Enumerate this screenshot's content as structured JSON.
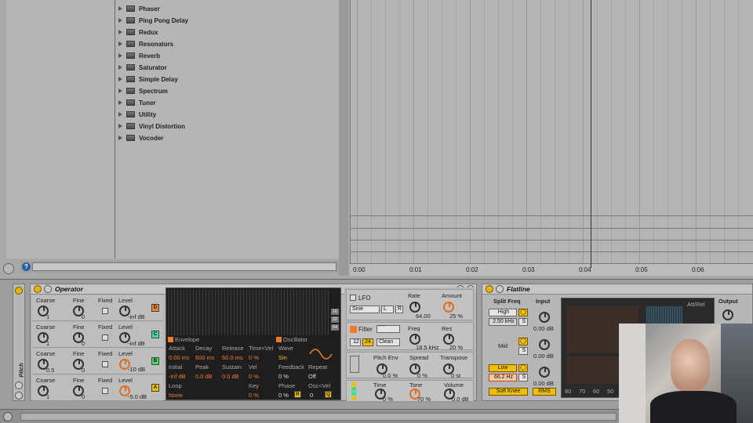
{
  "browser": {
    "items": [
      "Phaser",
      "Ping Pong Delay",
      "Redux",
      "Resonators",
      "Reverb",
      "Saturator",
      "Simple Delay",
      "Spectrum",
      "Tuner",
      "Utility",
      "Vinyl Distortion",
      "Vocoder"
    ],
    "help_label": "?"
  },
  "timeline": {
    "labels": [
      "0:00",
      "0:01",
      "0:02",
      "0:03",
      "0:04",
      "0:05",
      "0:06"
    ]
  },
  "operator": {
    "title": "Operator",
    "track_label": "Pitch",
    "headers": {
      "coarse": "Coarse",
      "fine": "Fine",
      "fixed": "Fixed",
      "level": "Level"
    },
    "rows": [
      {
        "coarse": "1",
        "fine": "0",
        "level": "-inf dB",
        "letter": "D",
        "color": "#f08c2a"
      },
      {
        "coarse": "1",
        "fine": "0",
        "level": "-inf dB",
        "letter": "C",
        "color": "#44dda0"
      },
      {
        "coarse": "0.5",
        "fine": "0",
        "level": "-10 dB",
        "letter": "B",
        "color": "#44dd66"
      },
      {
        "coarse": "1",
        "fine": "0",
        "level": "-5.0 dB",
        "letter": "A",
        "color": "#f0c000"
      }
    ],
    "display": {
      "side_tabs": [
        "16",
        "32",
        "64"
      ],
      "envelope_label": "Envelope",
      "oscillator_label": "Oscillator",
      "attack_label": "Attack",
      "attack": "0.00 ms",
      "decay_label": "Decay",
      "decay": "600 ms",
      "release_label": "Release",
      "release": "50.0 ms",
      "timevel_label": "Time<Vel",
      "timevel": "0 %",
      "wave_label": "Wave",
      "wave": "Sin",
      "initial_label": "Initial",
      "initial": "-inf dB",
      "peak_label": "Peak",
      "peak": "0.0 dB",
      "sustain_label": "Sustain",
      "sustain": "0.0 dB",
      "vel_label": "Vel",
      "vel": "0 %",
      "feedback_label": "Feedback",
      "feedback": "0 %",
      "repeat_label": "Repeat",
      "repeat": "Off",
      "loop_label": "Loop",
      "loop": "None",
      "key_label": "Key",
      "key": "0 %",
      "phase_label": "Phase",
      "phase": "0 %",
      "phase_r": "R",
      "oscvel_label": "Osc<Vel",
      "oscvel": "0",
      "q_label": "Q"
    },
    "lfo": {
      "label": "LFO",
      "wave": "Sine",
      "mode": "L",
      "r": "R",
      "rate_label": "Rate",
      "rate": "64.00",
      "amount_label": "Amount",
      "amount": "25 %"
    },
    "filter": {
      "label": "Filter",
      "slope12": "12",
      "slope24": "24",
      "type": "Clean",
      "freq_label": "Freq",
      "freq": "18.5 kHz",
      "res_label": "Res",
      "res": "20 %"
    },
    "pitch_env": {
      "label": "Pitch Env",
      "value": "0.0 %",
      "spread_label": "Spread",
      "spread": "0 %",
      "transpose_label": "Transpose",
      "transpose": "0 st"
    },
    "bottom": {
      "time_label": "Time",
      "time": "0 %",
      "tone_label": "Tone",
      "tone": "70 %",
      "volume_label": "Volume",
      "volume": "0.0 dB"
    }
  },
  "flatline": {
    "title": "Flatline",
    "split_label": "Split Freq",
    "high_label": "High",
    "high_freq": "2.50 kHz",
    "mid_label": "Mid",
    "low_label": "Low",
    "low_freq": "66.2 Hz",
    "s_label": "S",
    "input_label": "Input",
    "input_values": [
      "0.00 dB",
      "0.00 dB",
      "0.00 dB"
    ],
    "soft_knee": "Soft Knee",
    "rms": "RMS",
    "att_rel": "Att/Rel",
    "output_label": "Output",
    "scale": [
      "80",
      "70",
      "60",
      "50",
      "40"
    ]
  }
}
